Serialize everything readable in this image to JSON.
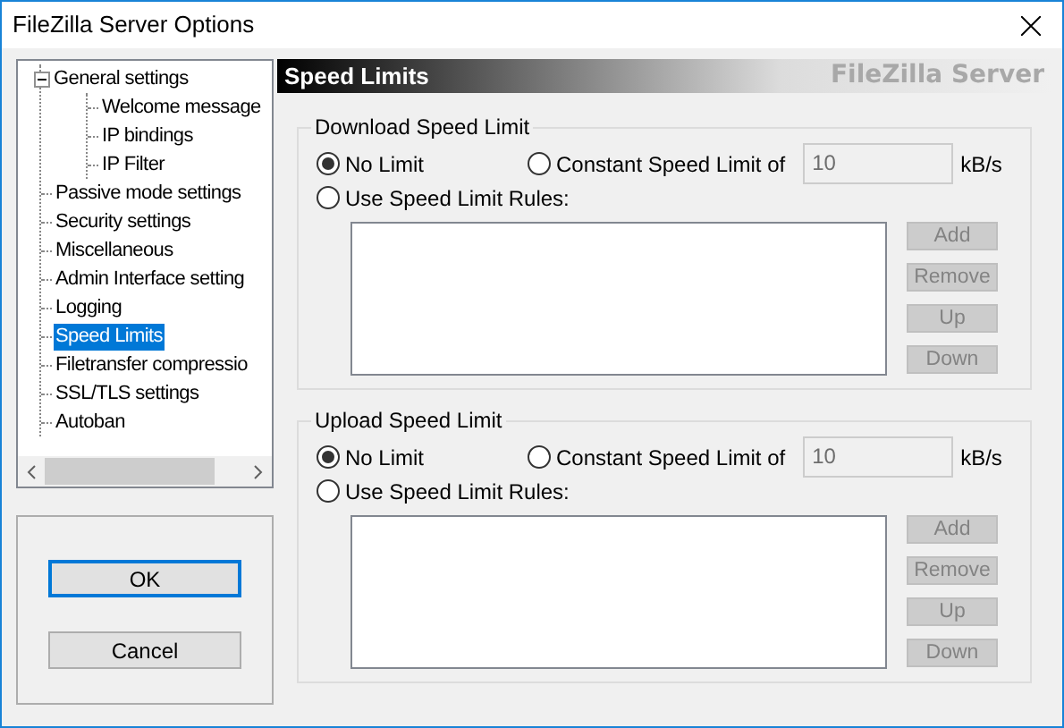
{
  "window": {
    "title": "FileZilla Server Options"
  },
  "tree": {
    "items": [
      {
        "label": "General settings",
        "expanded": true,
        "selected": false,
        "children": [
          {
            "label": "Welcome message",
            "selected": false
          },
          {
            "label": "IP bindings",
            "selected": false
          },
          {
            "label": "IP Filter",
            "selected": false
          }
        ]
      },
      {
        "label": "Passive mode settings",
        "selected": false
      },
      {
        "label": "Security settings",
        "selected": false
      },
      {
        "label": "Miscellaneous",
        "selected": false
      },
      {
        "label": "Admin Interface setting",
        "selected": false
      },
      {
        "label": "Logging",
        "selected": false
      },
      {
        "label": "Speed Limits",
        "selected": true
      },
      {
        "label": "Filetransfer compressio",
        "selected": false
      },
      {
        "label": "SSL/TLS settings",
        "selected": false
      },
      {
        "label": "Autoban",
        "selected": false
      }
    ]
  },
  "dialog_buttons": [
    {
      "label": "OK",
      "default": true
    },
    {
      "label": "Cancel",
      "default": false
    }
  ],
  "header": {
    "title": "Speed Limits",
    "brand": "FileZilla Server"
  },
  "groups": [
    {
      "legend": "Download Speed Limit",
      "options": [
        {
          "label": "No Limit",
          "selected": true
        },
        {
          "label": "Constant Speed Limit of",
          "selected": false
        },
        {
          "label": "Use Speed Limit Rules:",
          "selected": false
        }
      ],
      "value": "10",
      "unit": "kB/s",
      "buttons": [
        {
          "label": "Add",
          "disabled": true
        },
        {
          "label": "Remove",
          "disabled": true
        },
        {
          "label": "Up",
          "disabled": true
        },
        {
          "label": "Down",
          "disabled": true
        }
      ]
    },
    {
      "legend": "Upload Speed Limit",
      "options": [
        {
          "label": "No Limit",
          "selected": true
        },
        {
          "label": "Constant Speed Limit of",
          "selected": false
        },
        {
          "label": "Use Speed Limit Rules:",
          "selected": false
        }
      ],
      "value": "10",
      "unit": "kB/s",
      "buttons": [
        {
          "label": "Add",
          "disabled": true
        },
        {
          "label": "Remove",
          "disabled": true
        },
        {
          "label": "Up",
          "disabled": true
        },
        {
          "label": "Down",
          "disabled": true
        }
      ]
    }
  ]
}
